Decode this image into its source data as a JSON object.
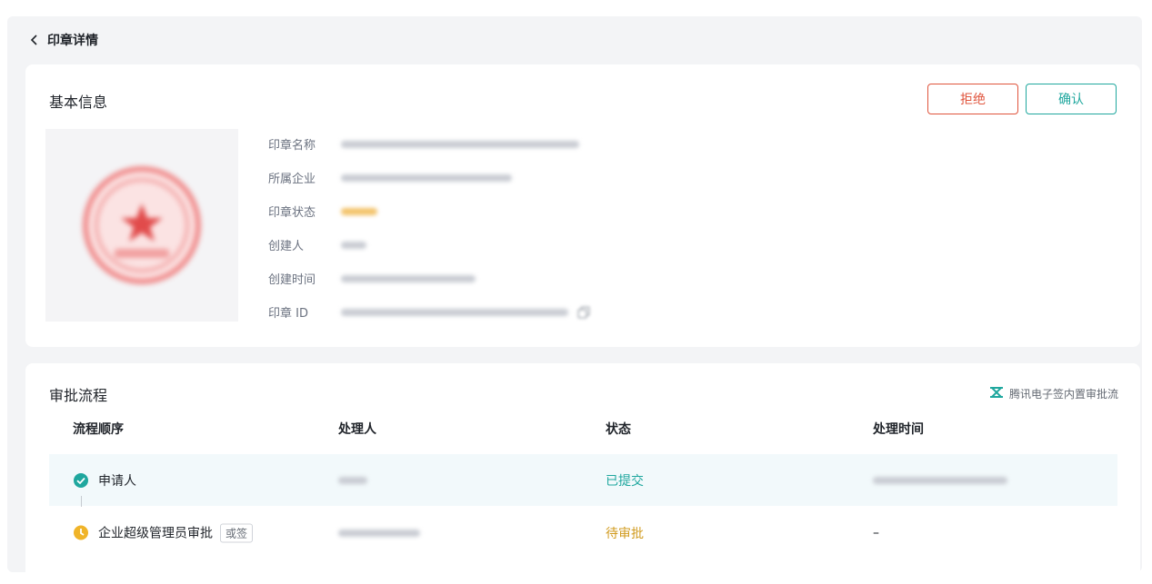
{
  "header": {
    "back_icon": "chevron-left-icon",
    "title": "印章详情"
  },
  "basic_info": {
    "title": "基本信息",
    "reject_label": "拒绝",
    "confirm_label": "确认",
    "colors": {
      "reject": "#e0543c",
      "confirm": "#1fa79e"
    },
    "fields": [
      {
        "label": "印章名称"
      },
      {
        "label": "所属企业"
      },
      {
        "label": "印章状态"
      },
      {
        "label": "创建人"
      },
      {
        "label": "创建时间"
      },
      {
        "label": "印章 ID"
      }
    ]
  },
  "approval": {
    "title": "审批流程",
    "link_icon": "workflow-icon",
    "link_label": "腾讯电子签内置审批流",
    "columns": [
      "流程顺序",
      "处理人",
      "状态",
      "处理时间"
    ],
    "rows": [
      {
        "step": "申请人",
        "status": "已提交",
        "status_color": "#1fa79e",
        "icon": "check-circle-icon"
      },
      {
        "step": "企业超级管理员审批",
        "tag": "或签",
        "status": "待审批",
        "status_color": "#d19b1f",
        "time": "–",
        "icon": "clock-icon"
      }
    ]
  }
}
